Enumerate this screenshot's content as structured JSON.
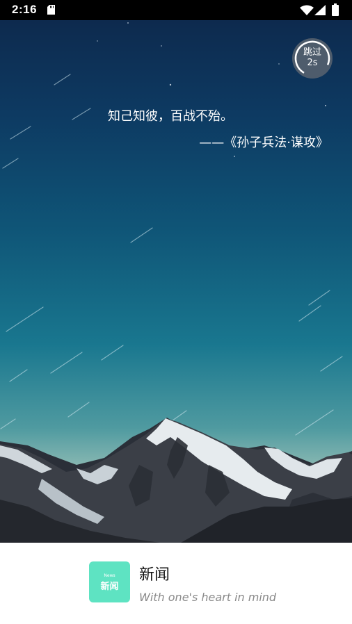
{
  "status_bar": {
    "time": "2:16",
    "icons": [
      "sd-card-icon",
      "wifi-icon",
      "cell-signal-icon",
      "battery-icon"
    ]
  },
  "splash": {
    "skip": {
      "label": "跳过",
      "countdown": "2s"
    },
    "quote": "知己知彼，百战不殆。",
    "source": "——《孙子兵法·谋攻》"
  },
  "footer": {
    "logo_small_text": "News",
    "logo_text": "新闻",
    "app_name": "新闻",
    "tagline": "With one's heart in mind"
  },
  "colors": {
    "sky_top": "#0d2a4e",
    "sky_bottom": "#c9d8c6",
    "logo_bg": "#5ee3c2",
    "skip_bg": "#5a6470"
  }
}
